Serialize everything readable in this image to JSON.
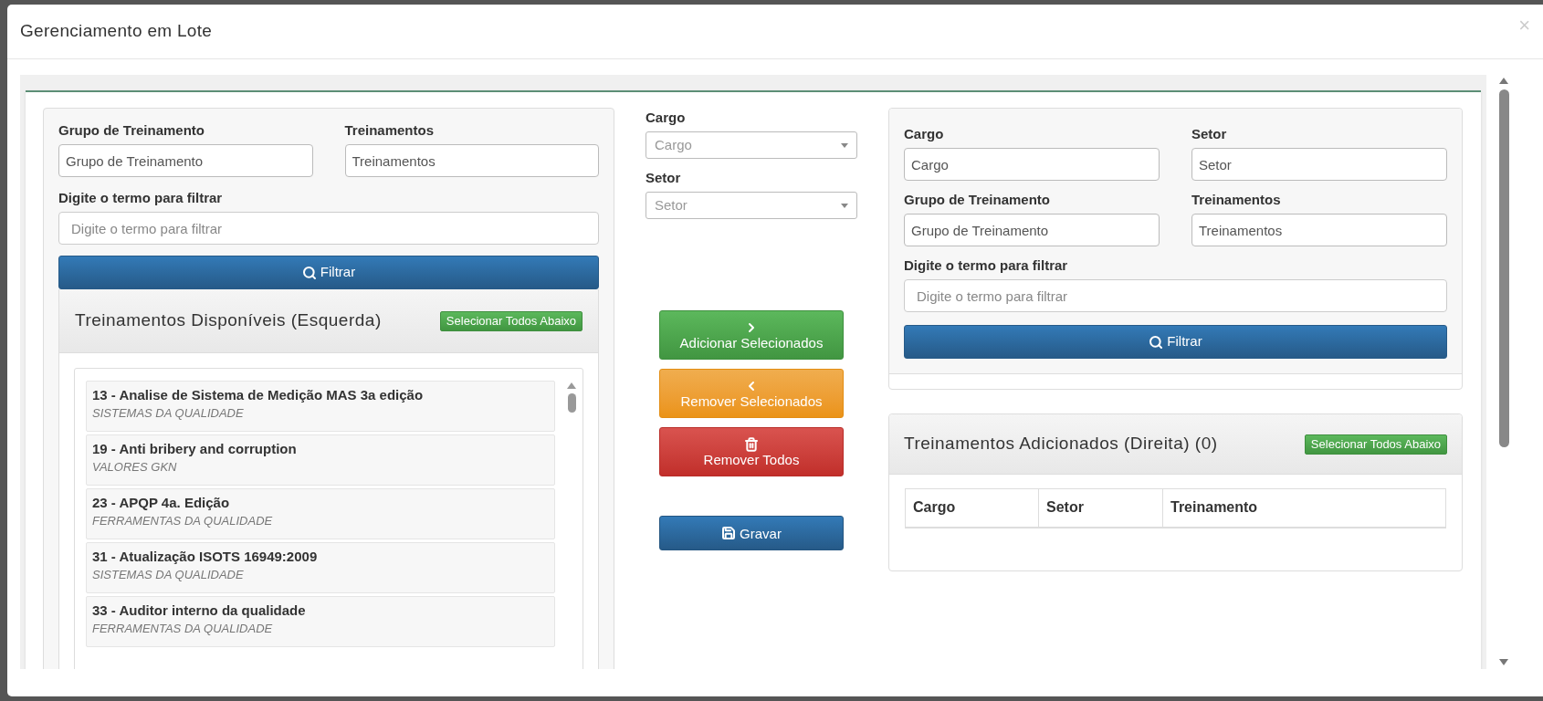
{
  "modal": {
    "title": "Gerenciamento em Lote",
    "close": "×"
  },
  "left_filter": {
    "fields": [
      {
        "label": "Grupo de Treinamento",
        "placeholder": "Grupo de Treinamento"
      },
      {
        "label": "Treinamentos",
        "placeholder": "Treinamentos"
      }
    ],
    "search": {
      "label": "Digite o termo para filtrar",
      "placeholder": "Digite o termo para filtrar"
    },
    "filter_button": "Filtrar"
  },
  "available": {
    "title": "Treinamentos Disponíveis (Esquerda)",
    "select_all": "Selecionar Todos Abaixo",
    "items": [
      {
        "title": "13 - Analise de Sistema de Medição MAS 3a edição",
        "category": "SISTEMAS DA QUALIDADE"
      },
      {
        "title": "19 - Anti bribery and corruption",
        "category": "VALORES GKN"
      },
      {
        "title": "23 - APQP 4a. Edição",
        "category": "FERRAMENTAS DA QUALIDADE"
      },
      {
        "title": "31 - Atualização ISOTS 16949:2009",
        "category": "SISTEMAS DA QUALIDADE"
      },
      {
        "title": "33 - Auditor interno da qualidade",
        "category": "FERRAMENTAS DA QUALIDADE"
      }
    ]
  },
  "middle": {
    "selects": [
      {
        "label": "Cargo",
        "placeholder": "Cargo"
      },
      {
        "label": "Setor",
        "placeholder": "Setor"
      }
    ],
    "buttons": [
      {
        "label": "Adicionar Selecionados",
        "kind": "add"
      },
      {
        "label": "Remover Selecionados",
        "kind": "remove"
      },
      {
        "label": "Remover Todos",
        "kind": "remove_all"
      },
      {
        "label": "Gravar",
        "kind": "save"
      }
    ]
  },
  "right_filter": {
    "fields": [
      {
        "label": "Cargo",
        "placeholder": "Cargo"
      },
      {
        "label": "Setor",
        "placeholder": "Setor"
      },
      {
        "label": "Grupo de Treinamento",
        "placeholder": "Grupo de Treinamento"
      },
      {
        "label": "Treinamentos",
        "placeholder": "Treinamentos"
      }
    ],
    "search": {
      "label": "Digite o termo para filtrar",
      "placeholder": "Digite o termo para filtrar"
    },
    "filter_button": "Filtrar"
  },
  "added": {
    "title": "Treinamentos Adicionados (Direita) (0)",
    "select_all": "Selecionar Todos Abaixo",
    "columns": [
      "Cargo",
      "Setor",
      "Treinamento"
    ]
  }
}
